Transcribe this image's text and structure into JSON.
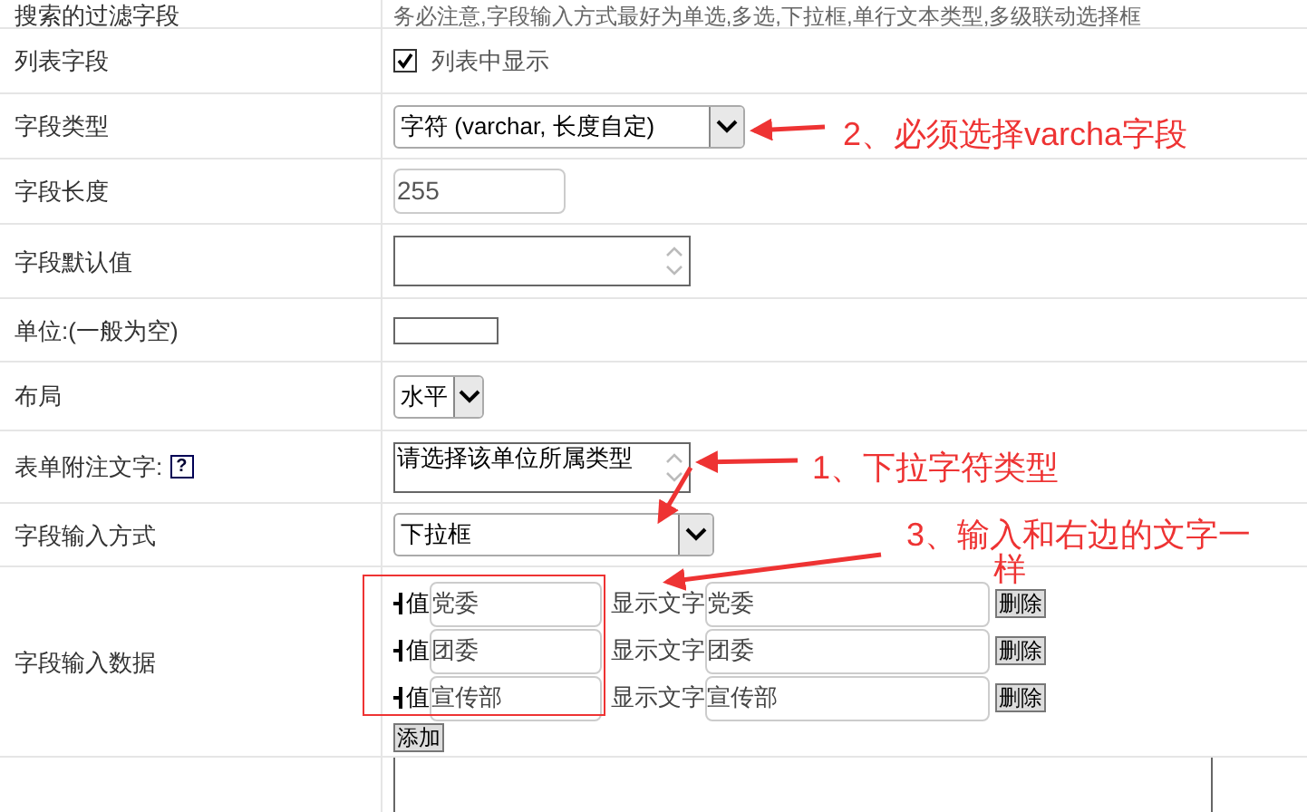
{
  "rows": [
    {
      "kind": "note",
      "label": "搜索的过滤字段",
      "text": "务必注意,字段输入方式最好为单选,多选,下拉框,单行文本类型,多级联动选择框"
    },
    {
      "kind": "checkbox",
      "label": "列表字段",
      "checked": true,
      "text": "列表中显示"
    },
    {
      "kind": "select",
      "label": "字段类型",
      "value": "字符 (varchar, 长度自定)"
    },
    {
      "kind": "input",
      "label": "字段长度",
      "value": "255"
    },
    {
      "kind": "textarea",
      "label": "字段默认值"
    },
    {
      "kind": "input",
      "label": "单位:(一般为空)"
    },
    {
      "kind": "select",
      "label": "布局",
      "value": "水平"
    },
    {
      "kind": "textarea",
      "label": "表单附注文字:",
      "help": "?",
      "value": "请选择该单位所属类型"
    },
    {
      "kind": "select",
      "label": "字段输入方式",
      "value": "下拉框"
    },
    {
      "kind": "options",
      "label": "字段输入数据",
      "add": "添加",
      "items": [
        {
          "value_label": "值",
          "value": "党委",
          "display_label": "显示文字",
          "display": "党委",
          "delete": "删除"
        },
        {
          "value_label": "值",
          "value": "团委",
          "display_label": "显示文字",
          "display": "团委",
          "delete": "删除"
        },
        {
          "value_label": "值",
          "value": "宣传部",
          "display_label": "显示文字",
          "display": "宣传部",
          "delete": "删除"
        }
      ]
    },
    {
      "kind": "textarea"
    }
  ],
  "annotations": [
    "2、必须选择varcha字段",
    "1、下拉字符类型",
    "3、输入和右边的文字一样"
  ]
}
